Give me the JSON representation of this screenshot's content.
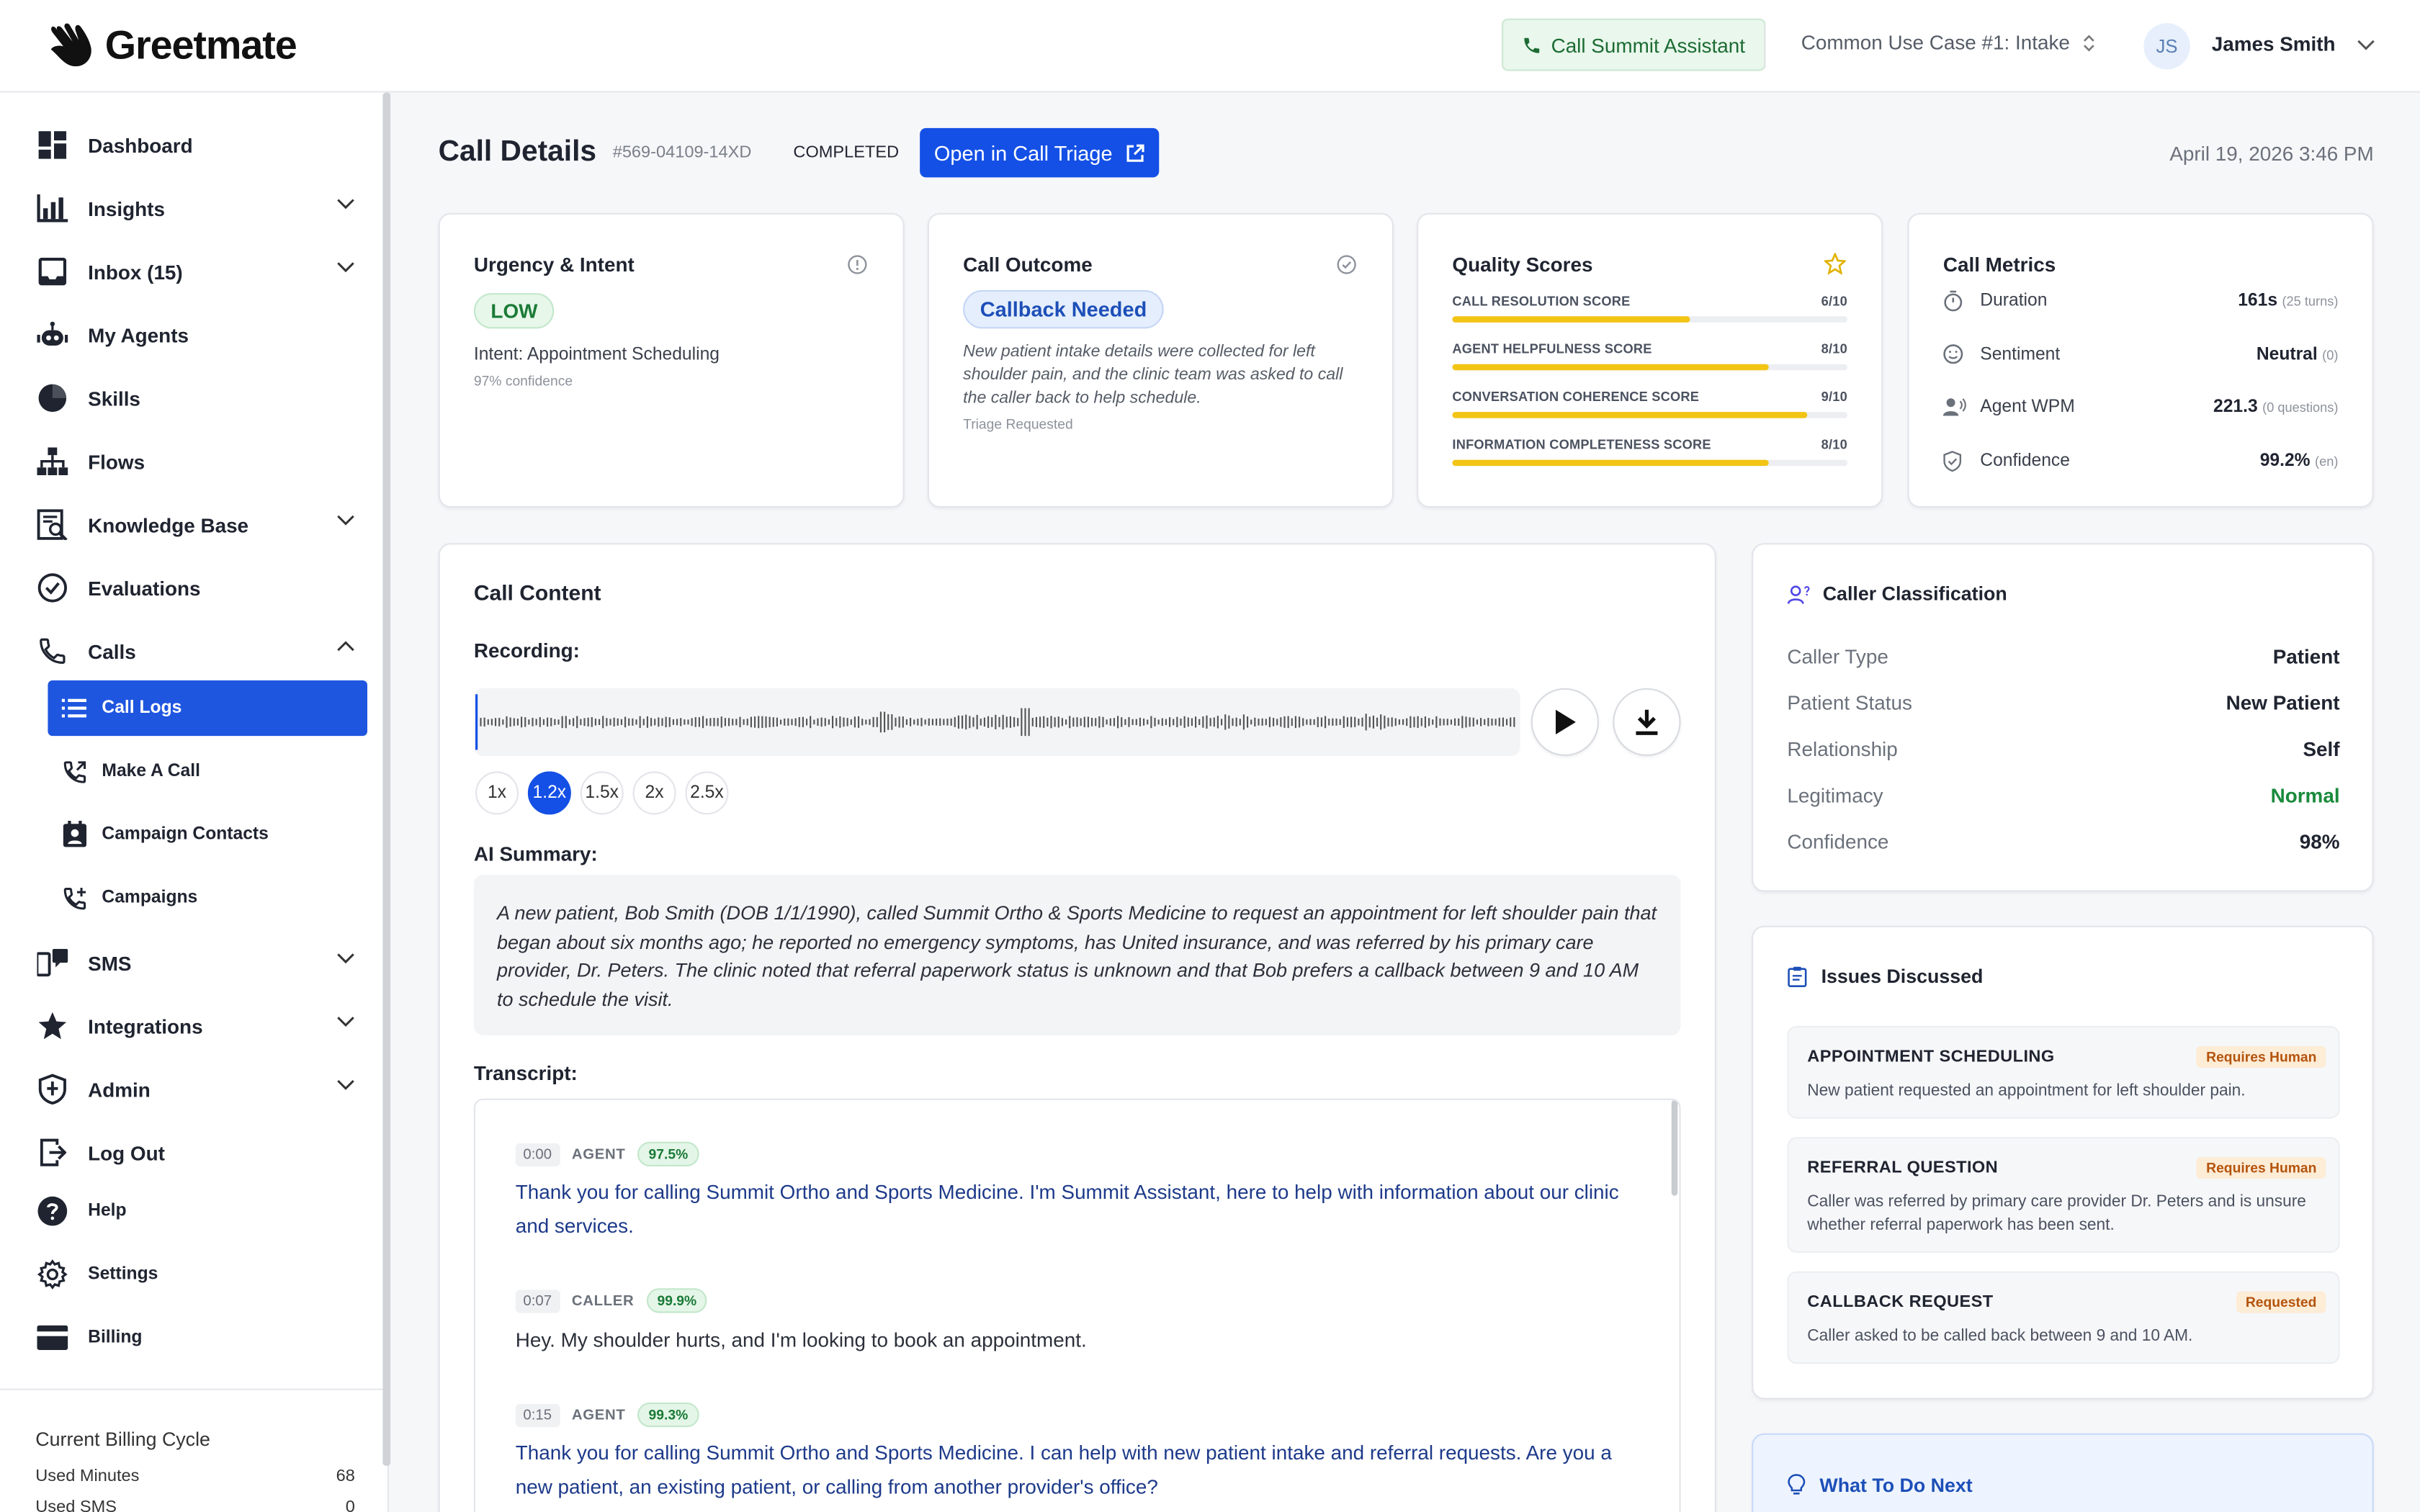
{
  "app": {
    "brand": "Greetmate",
    "assistant_button": "Call Summit Assistant",
    "use_case": "Common Use Case #1: Intake",
    "user_initials": "JS",
    "user_name": "James Smith"
  },
  "sidebar": {
    "items": [
      {
        "label": "Dashboard",
        "icon": "dashboard-icon"
      },
      {
        "label": "Insights",
        "icon": "bar-chart-icon"
      },
      {
        "label": "Inbox (15)",
        "icon": "inbox-icon"
      },
      {
        "label": "My Agents",
        "icon": "robot-icon"
      },
      {
        "label": "Skills",
        "icon": "pie-icon"
      },
      {
        "label": "Flows",
        "icon": "flow-icon"
      },
      {
        "label": "Knowledge Base",
        "icon": "knowledge-icon"
      },
      {
        "label": "Evaluations",
        "icon": "check-circle-icon"
      },
      {
        "label": "Calls",
        "icon": "phone-icon"
      },
      {
        "label": "SMS",
        "icon": "sms-icon"
      },
      {
        "label": "Integrations",
        "icon": "star-icon"
      },
      {
        "label": "Admin",
        "icon": "shield-icon"
      },
      {
        "label": "Log Out",
        "icon": "logout-icon"
      },
      {
        "label": "Help",
        "icon": "help-icon"
      },
      {
        "label": "Settings",
        "icon": "gear-icon"
      },
      {
        "label": "Billing",
        "icon": "card-icon"
      }
    ],
    "calls_sub": [
      {
        "label": "Call Logs"
      },
      {
        "label": "Make A Call"
      },
      {
        "label": "Campaign Contacts"
      },
      {
        "label": "Campaigns"
      }
    ],
    "billing": {
      "title": "Current Billing Cycle",
      "used_minutes_label": "Used Minutes",
      "used_minutes_value": "68",
      "used_sms_label": "Used SMS",
      "used_sms_value": "0"
    }
  },
  "header": {
    "title": "Call Details",
    "call_id": "#569-04109-14XD",
    "status": "COMPLETED",
    "triage_button": "Open in Call Triage",
    "date": "April 19, 2026 3:46 PM"
  },
  "urgency": {
    "title": "Urgency & Intent",
    "level": "LOW",
    "intent": "Intent: Appointment Scheduling",
    "confidence": "97% confidence"
  },
  "outcome": {
    "title": "Call Outcome",
    "badge": "Callback Needed",
    "description": "New patient intake details were collected for left shoulder pain, and the clinic team was asked to call the caller back to help schedule.",
    "footnote": "Triage Requested"
  },
  "quality": {
    "title": "Quality Scores",
    "scores": [
      {
        "label": "CALL RESOLUTION SCORE",
        "value": "6/10",
        "fraction": 0.6
      },
      {
        "label": "AGENT HELPFULNESS SCORE",
        "value": "8/10",
        "fraction": 0.8
      },
      {
        "label": "CONVERSATION COHERENCE SCORE",
        "value": "9/10",
        "fraction": 0.9
      },
      {
        "label": "INFORMATION COMPLETENESS SCORE",
        "value": "8/10",
        "fraction": 0.8
      }
    ]
  },
  "metrics": {
    "title": "Call Metrics",
    "rows": [
      {
        "label": "Duration",
        "value": "161s",
        "sub": "(25 turns)",
        "icon": "stopwatch-icon"
      },
      {
        "label": "Sentiment",
        "value": "Neutral",
        "sub": "(0)",
        "icon": "smile-icon"
      },
      {
        "label": "Agent WPM",
        "value": "221.3",
        "sub": "(0 questions)",
        "icon": "speaker-icon"
      },
      {
        "label": "Confidence",
        "value": "99.2%",
        "sub": "(en)",
        "icon": "shield-check-icon"
      }
    ]
  },
  "content": {
    "title": "Call Content",
    "recording_label": "Recording:",
    "speeds": [
      "1x",
      "1.2x",
      "1.5x",
      "2x",
      "2.5x"
    ],
    "active_speed": "1.2x",
    "summary_label": "AI Summary:",
    "summary": "A new patient, Bob Smith (DOB 1/1/1990), called Summit Ortho & Sports Medicine to request an appointment for left shoulder pain that began about six months ago; he reported no emergency symptoms, has United insurance, and was referred by his primary care provider, Dr. Peters. The clinic noted that referral paperwork status is unknown and that Bob prefers a callback between 9 and 10 AM to schedule the visit.",
    "transcript_label": "Transcript:",
    "transcript": [
      {
        "time": "0:00",
        "role": "AGENT",
        "confidence": "97.5%",
        "text": "Thank you for calling Summit Ortho and Sports Medicine. I'm Summit Assistant, here to help with information about our clinic and services."
      },
      {
        "time": "0:07",
        "role": "CALLER",
        "confidence": "99.9%",
        "text": "Hey. My shoulder hurts, and I'm looking to book an appointment."
      },
      {
        "time": "0:15",
        "role": "AGENT",
        "confidence": "99.3%",
        "text": "Thank you for calling Summit Ortho and Sports Medicine. I can help with new patient intake and referral requests. Are you a new patient, an existing patient, or calling from another provider's office?"
      }
    ]
  },
  "classification": {
    "title": "Caller Classification",
    "rows": [
      {
        "label": "Caller Type",
        "value": "Patient"
      },
      {
        "label": "Patient Status",
        "value": "New Patient"
      },
      {
        "label": "Relationship",
        "value": "Self"
      },
      {
        "label": "Legitimacy",
        "value": "Normal"
      },
      {
        "label": "Confidence",
        "value": "98%"
      }
    ],
    "legitimacy_color": "#1a8a3c"
  },
  "issues": {
    "title": "Issues Discussed",
    "items": [
      {
        "title": "APPOINTMENT SCHEDULING",
        "badge": "Requires Human",
        "desc": "New patient requested an appointment for left shoulder pain."
      },
      {
        "title": "REFERRAL QUESTION",
        "badge": "Requires Human",
        "desc": "Caller was referred by primary care provider Dr. Peters and is unsure whether referral paperwork has been sent."
      },
      {
        "title": "CALLBACK REQUEST",
        "badge": "Requested",
        "desc": "Caller asked to be called back between 9 and 10 AM."
      }
    ]
  },
  "next": {
    "title": "What To Do Next"
  },
  "colors": {
    "accent": "#1450e6",
    "quality_bar": "#f2c414",
    "success": "#1a7a36"
  }
}
